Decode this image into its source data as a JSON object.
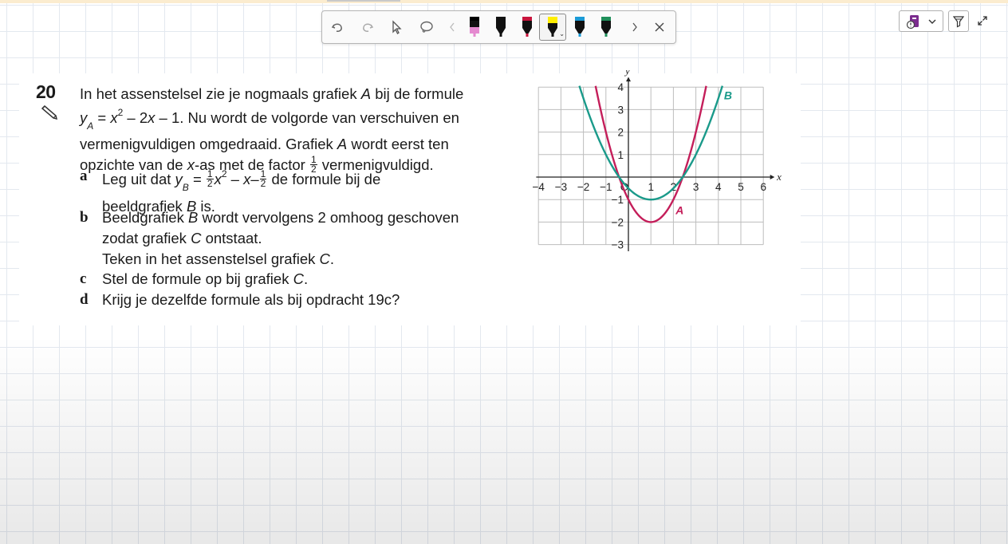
{
  "toolbar": {
    "tools": [
      "undo-icon",
      "redo-icon",
      "select-icon",
      "lasso-icon",
      "prev-icon"
    ],
    "pens": [
      {
        "name": "pen-black-pink",
        "color": "#000000",
        "tip": "#e58ad0"
      },
      {
        "name": "pen-black",
        "color": "#111111",
        "tip": "#111111"
      },
      {
        "name": "pen-red",
        "color": "#c8143c",
        "tip": "#c8143c"
      },
      {
        "name": "highlighter-yellow",
        "color": "#ffee00",
        "tip": "#111111",
        "selected": true
      },
      {
        "name": "pen-blue",
        "color": "#1b9ad6",
        "tip": "#1b9ad6"
      },
      {
        "name": "pen-green",
        "color": "#1f8f5a",
        "tip": "#1f8f5a"
      }
    ],
    "after": [
      "next-icon",
      "close-icon"
    ]
  },
  "question": {
    "number": "20",
    "intro_lines": [
      "In het assenstelsel zie je nogmaals grafiek",
      "formule",
      "Nu wordt de volgorde van verschuiven en",
      "vermenigvuldigen omgedraaid. Grafiek",
      "wordt eerst ten",
      "opzichte van de",
      "-as met de factor",
      "vermenigvuldigd."
    ],
    "symbols": {
      "A": "A",
      "B": "B",
      "C": "C",
      "x": "x",
      "y": "y",
      "sub_A": "A",
      "sub_B": "B",
      "half_num": "1",
      "half_den": "2",
      "sq": "2"
    },
    "formula_A_rest": " = ",
    "formula_A_tail": " – 2",
    "formula_A_end": " – 1.",
    "bij_de": " bij de",
    "items": [
      {
        "label": "a",
        "lines": [
          "Leg uit dat",
          "de formule bij de",
          "beeldgrafiek",
          "is."
        ]
      },
      {
        "label": "b",
        "lines": [
          "Beeldgrafiek",
          "wordt vervolgens 2 omhoog geschoven",
          "zodat grafiek",
          "ontstaat.",
          "Teken in het assenstelsel grafiek",
          "."
        ]
      },
      {
        "label": "c",
        "lines": [
          "Stel de formule op bij grafiek",
          "."
        ]
      },
      {
        "label": "d",
        "lines": [
          "Krijg je dezelfde formule als bij opdracht 19c?"
        ]
      }
    ]
  },
  "chart_data": {
    "type": "line",
    "title": "",
    "xlabel": "x",
    "ylabel": "y",
    "xlim": [
      -4,
      6
    ],
    "ylim": [
      -3,
      4
    ],
    "x_ticks": [
      "−4",
      "−3",
      "−2",
      "−1",
      "O",
      "1",
      "2",
      "3",
      "4",
      "5",
      "6"
    ],
    "y_ticks": [
      "4",
      "3",
      "2",
      "1",
      "−1",
      "−2",
      "−3"
    ],
    "grid": true,
    "series": [
      {
        "name": "A",
        "formula": "x^2 - 2x - 1",
        "color": "#c41e5a"
      },
      {
        "name": "B",
        "formula": "0.5x^2 - x - 0.5",
        "color": "#1a9a8a"
      }
    ]
  }
}
